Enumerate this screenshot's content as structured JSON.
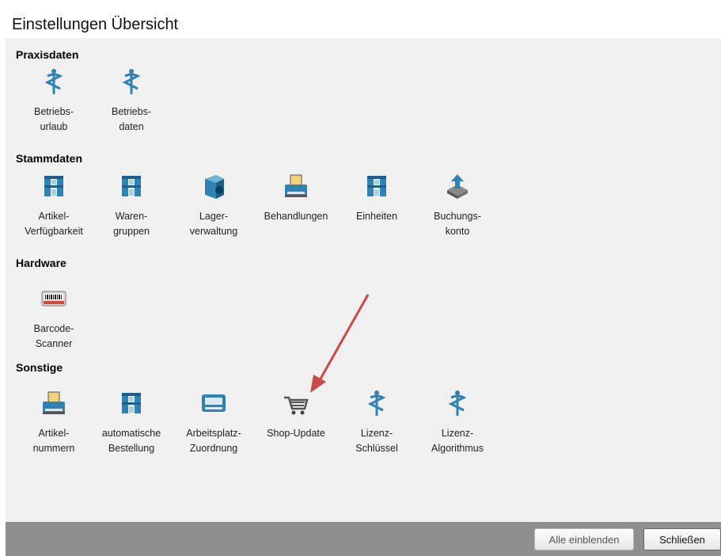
{
  "dialog": {
    "title": "Einstellungen Übersicht"
  },
  "sections": [
    {
      "title": "Praxisdaten",
      "items": [
        {
          "line1": "Betriebs-",
          "line2": "urlaub",
          "icon": "caduceus-icon"
        },
        {
          "line1": "Betriebs-",
          "line2": "daten",
          "icon": "caduceus-icon"
        }
      ]
    },
    {
      "title": "Stammdaten",
      "items": [
        {
          "line1": "Artikel-",
          "line2": "Verfügbarkeit",
          "icon": "shelf-icon"
        },
        {
          "line1": "Waren-",
          "line2": "gruppen",
          "icon": "shelf-icon"
        },
        {
          "line1": "Lager-",
          "line2": "verwaltung",
          "icon": "storage-icon"
        },
        {
          "line1": "Behandlungen",
          "line2": "",
          "icon": "printer-icon"
        },
        {
          "line1": "Einheiten",
          "line2": "",
          "icon": "shelf-icon"
        },
        {
          "line1": "Buchungs-",
          "line2": "konto",
          "icon": "account-icon"
        }
      ]
    },
    {
      "title": "Hardware",
      "items": [
        {
          "line1": "Barcode-",
          "line2": "Scanner",
          "icon": "barcode-scanner-icon"
        }
      ]
    },
    {
      "title": "Sonstige",
      "items": [
        {
          "line1": "Artikel-",
          "line2": "nummern",
          "icon": "printer-icon"
        },
        {
          "line1": "automatische",
          "line2": "Bestellung",
          "icon": "shelf-icon"
        },
        {
          "line1": "Arbeitsplatz-",
          "line2": "Zuordnung",
          "icon": "workstation-icon"
        },
        {
          "line1": "Shop-Update",
          "line2": "",
          "icon": "shopping-cart-icon"
        },
        {
          "line1": "Lizenz-",
          "line2": "Schlüssel",
          "icon": "caduceus-icon"
        },
        {
          "line1": "Lizenz-",
          "line2": "Algorithmus",
          "icon": "caduceus-icon"
        }
      ]
    }
  ],
  "footer": {
    "show_all_label": "Alle einblenden",
    "close_label": "Schließen"
  },
  "colors": {
    "icon_blue": "#2f83b3",
    "arrow": "#c84b45",
    "footer_bg": "#8f8f8f",
    "panel_bg": "#f0f0f0"
  }
}
